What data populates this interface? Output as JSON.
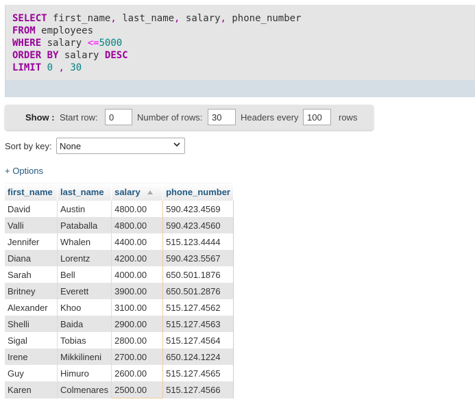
{
  "sql": {
    "line1": {
      "kw": "SELECT",
      "cols": [
        "first_name",
        "last_name",
        "salary",
        "phone_number"
      ]
    },
    "line2": {
      "kw": "FROM",
      "table": "employees"
    },
    "line3": {
      "kw": "WHERE",
      "col": "salary",
      "op": "<=",
      "value": "5000"
    },
    "line4": {
      "kw1": "ORDER BY",
      "col": "salary",
      "kw2": "DESC"
    },
    "line5": {
      "kw": "LIMIT",
      "start": "0",
      "sep": ",",
      "count": "30"
    }
  },
  "navigation": {
    "show_label": "Show :",
    "start_row_label": "Start row:",
    "start_row_value": "0",
    "num_rows_label": "Number of rows:",
    "num_rows_value": "30",
    "headers_every_label": "Headers every",
    "headers_every_value": "100",
    "rows_label": "rows"
  },
  "sort": {
    "label": "Sort by key:",
    "selected": "None"
  },
  "options_link": "+ Options",
  "table": {
    "columns": [
      "first_name",
      "last_name",
      "salary",
      "phone_number"
    ],
    "rows": [
      [
        "David",
        "Austin",
        "4800.00",
        "590.423.4569"
      ],
      [
        "Valli",
        "Pataballa",
        "4800.00",
        "590.423.4560"
      ],
      [
        "Jennifer",
        "Whalen",
        "4400.00",
        "515.123.4444"
      ],
      [
        "Diana",
        "Lorentz",
        "4200.00",
        "590.423.5567"
      ],
      [
        "Sarah",
        "Bell",
        "4000.00",
        "650.501.1876"
      ],
      [
        "Britney",
        "Everett",
        "3900.00",
        "650.501.2876"
      ],
      [
        "Alexander",
        "Khoo",
        "3100.00",
        "515.127.4562"
      ],
      [
        "Shelli",
        "Baida",
        "2900.00",
        "515.127.4563"
      ],
      [
        "Sigal",
        "Tobias",
        "2800.00",
        "515.127.4564"
      ],
      [
        "Irene",
        "Mikkilineni",
        "2700.00",
        "650.124.1224"
      ],
      [
        "Guy",
        "Himuro",
        "2600.00",
        "515.127.4565"
      ],
      [
        "Karen",
        "Colmenares",
        "2500.00",
        "515.127.4566"
      ]
    ]
  },
  "icons": {
    "sort_arrow": "sort-ascending-icon",
    "dropdown": "chevron-down-icon"
  }
}
